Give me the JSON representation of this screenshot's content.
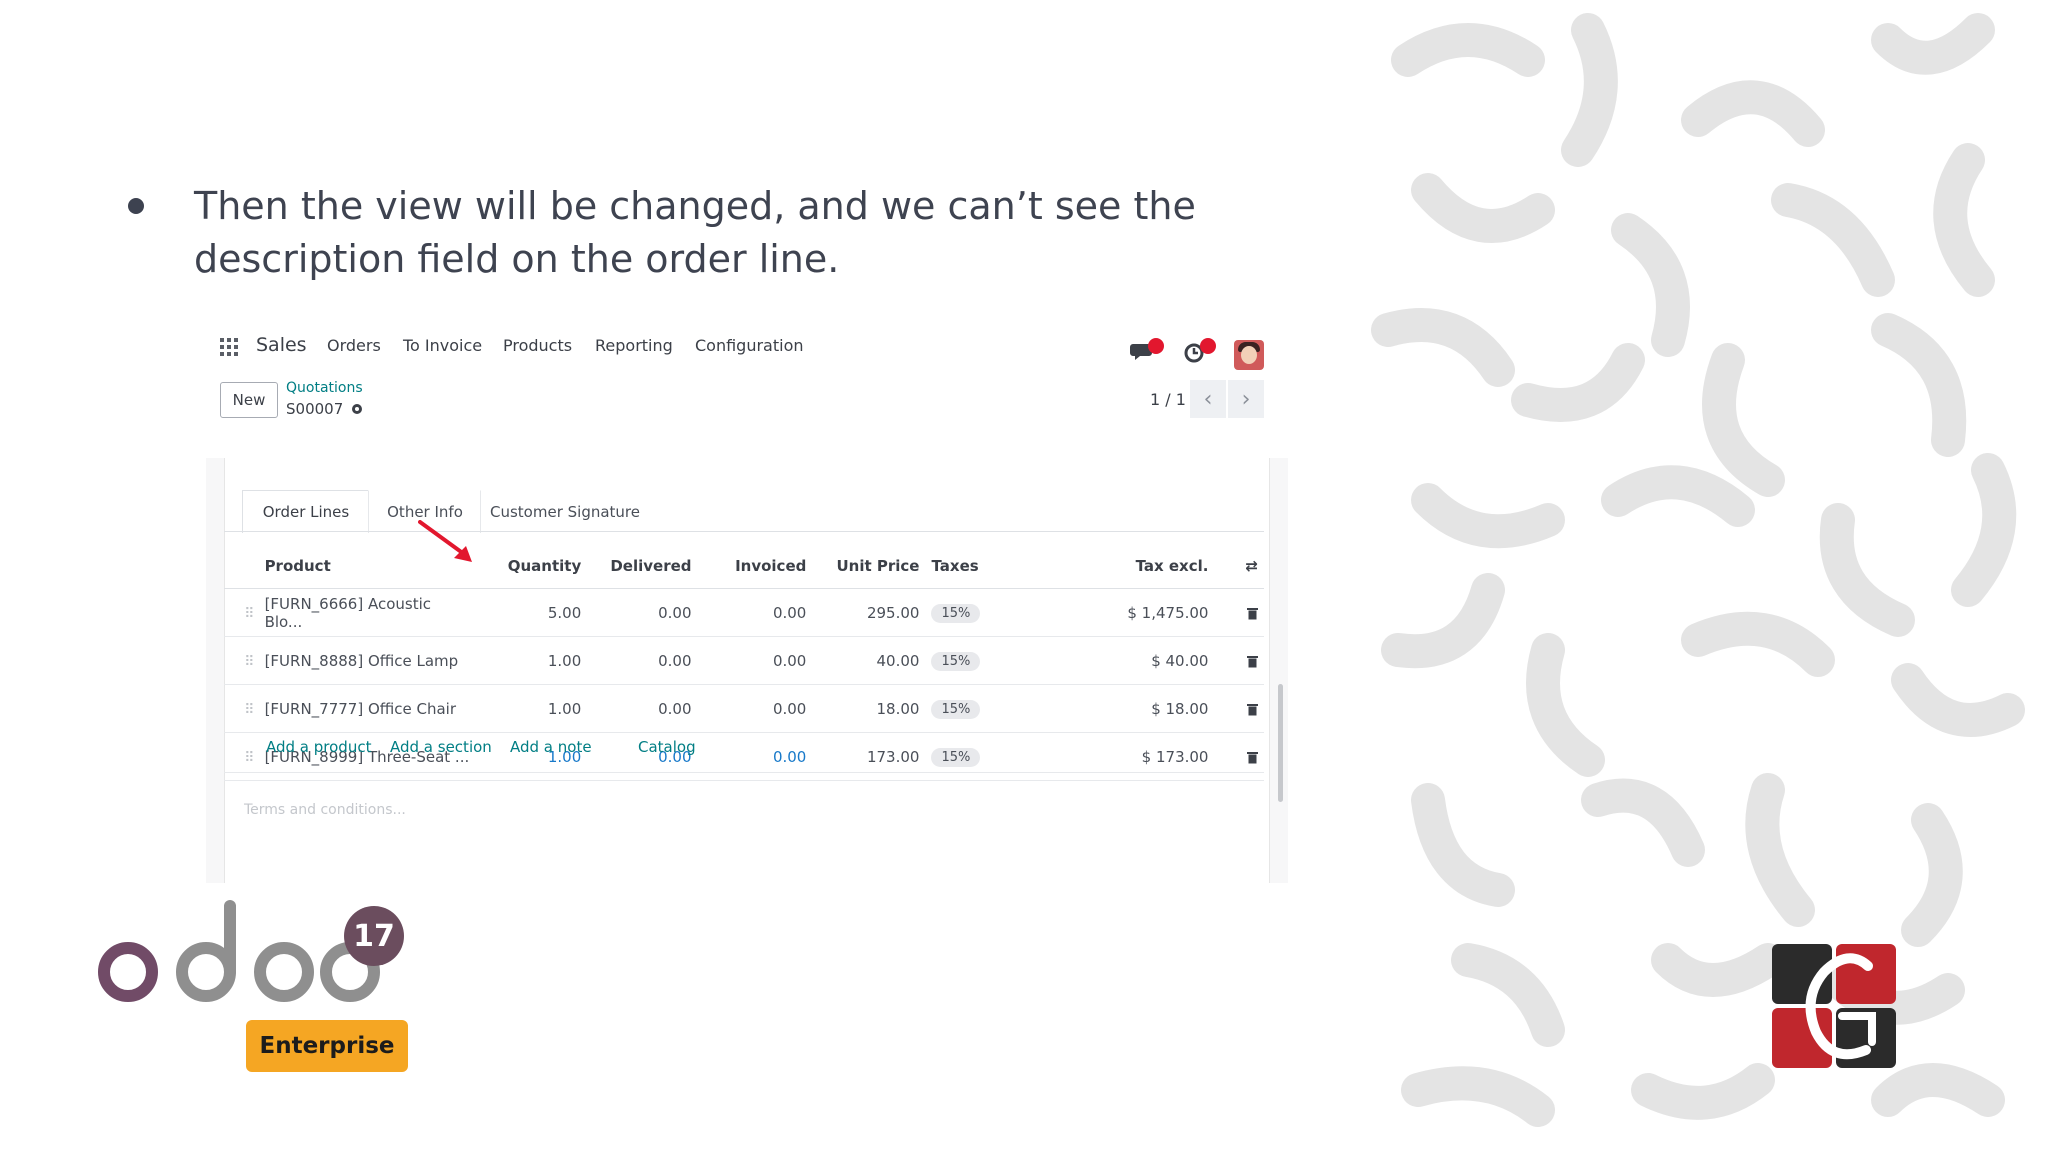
{
  "slide": {
    "bullet_text": "Then the view will be changed, and we can’t see the description field on the order line."
  },
  "navbar": {
    "app_name": "Sales",
    "menu": [
      "Orders",
      "To Invoice",
      "Products",
      "Reporting",
      "Configuration"
    ]
  },
  "control_panel": {
    "new_label": "New",
    "breadcrumb_parent": "Quotations",
    "record_name": "S00007",
    "pager": "1 / 1"
  },
  "tabs": [
    "Order Lines",
    "Other Info",
    "Customer Signature"
  ],
  "order_lines": {
    "columns": [
      "Product",
      "Quantity",
      "Delivered",
      "Invoiced",
      "Unit Price",
      "Taxes",
      "Tax excl."
    ],
    "rows": [
      {
        "product": "[FURN_6666] Acoustic Blo...",
        "quantity": "5.00",
        "delivered": "0.00",
        "invoiced": "0.00",
        "unit_price": "295.00",
        "taxes": "15%",
        "subtotal": "$ 1,475.00"
      },
      {
        "product": "[FURN_8888] Office Lamp",
        "quantity": "1.00",
        "delivered": "0.00",
        "invoiced": "0.00",
        "unit_price": "40.00",
        "taxes": "15%",
        "subtotal": "$ 40.00"
      },
      {
        "product": "[FURN_7777] Office Chair",
        "quantity": "1.00",
        "delivered": "0.00",
        "invoiced": "0.00",
        "unit_price": "18.00",
        "taxes": "15%",
        "subtotal": "$ 18.00"
      },
      {
        "product": "[FURN_8999] Three-Seat ...",
        "quantity": "1.00",
        "delivered": "0.00",
        "invoiced": "0.00",
        "unit_price": "173.00",
        "taxes": "15%",
        "subtotal": "$ 173.00"
      }
    ],
    "add_links": [
      "Add a product",
      "Add a section",
      "Add a note",
      "Catalog"
    ],
    "terms_placeholder": "Terms and conditions..."
  },
  "branding": {
    "version": "17",
    "edition": "Enterprise",
    "odoo_colors": {
      "purple": "#714b67",
      "grey": "#8f8f8f"
    },
    "edition_color": "#f5a623",
    "cg_colors": {
      "dark": "#2b2b2b",
      "red": "#c0272d"
    }
  }
}
